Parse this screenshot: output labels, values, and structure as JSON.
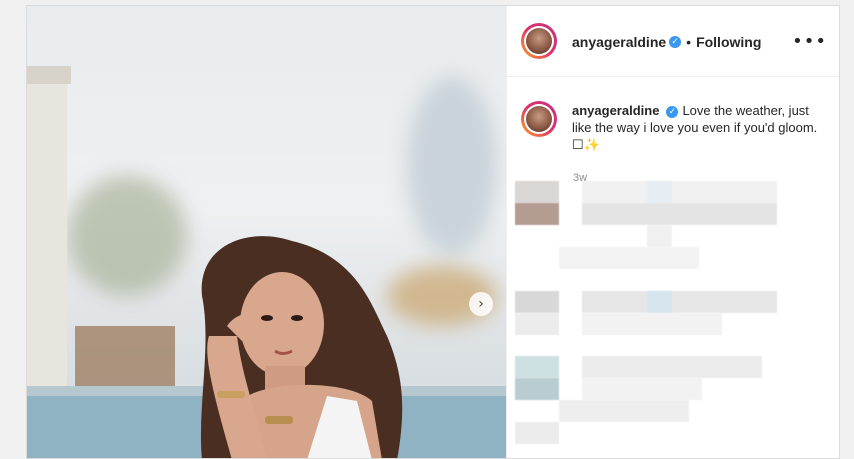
{
  "post": {
    "author": {
      "username": "anyageraldine",
      "verified_icon": "verified-badge-icon"
    },
    "follow_status": "Following",
    "more_icon": "•••",
    "separator": "•",
    "caption": "Love the weather, just like the way i love you even if you'd gloom. ",
    "caption_emoji": "☐✨",
    "time_ago": "3w",
    "next_icon": "›",
    "colors": {
      "verified": "#3897f0",
      "text": "#262626",
      "secondary": "#8e8e8e",
      "border": "#dbdbdb"
    }
  }
}
